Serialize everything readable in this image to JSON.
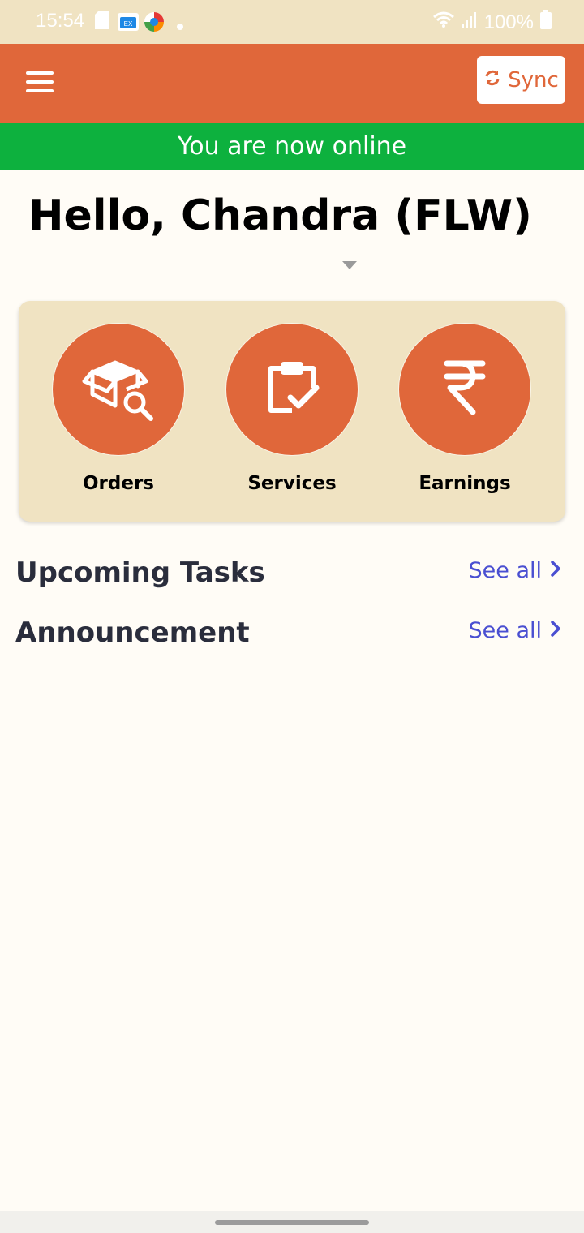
{
  "status_bar": {
    "time": "15:54",
    "battery": "100%",
    "icons": [
      "sd-card-icon",
      "file-explorer-icon",
      "browser-icon",
      "notification-dot-icon",
      "wifi-icon",
      "signal-icon",
      "battery-icon"
    ]
  },
  "app_bar": {
    "menu_icon": "hamburger-menu-icon",
    "sync_label": "Sync",
    "sync_icon": "sync-icon",
    "color": "#e0673a"
  },
  "banner": {
    "text": "You are now online",
    "color": "#0db13e"
  },
  "greeting": {
    "text": "Hello, Chandra (FLW)"
  },
  "quick_actions": [
    {
      "label": "Orders",
      "icon": "box-search-icon"
    },
    {
      "label": "Services",
      "icon": "clipboard-check-icon"
    },
    {
      "label": "Earnings",
      "icon": "rupee-icon"
    }
  ],
  "sections": [
    {
      "title": "Upcoming Tasks",
      "link": "See all"
    },
    {
      "title": "Announcement",
      "link": "See all"
    }
  ],
  "colors": {
    "background": "#fffcf6",
    "card": "#f0e3c2",
    "link": "#4a4fd1"
  }
}
